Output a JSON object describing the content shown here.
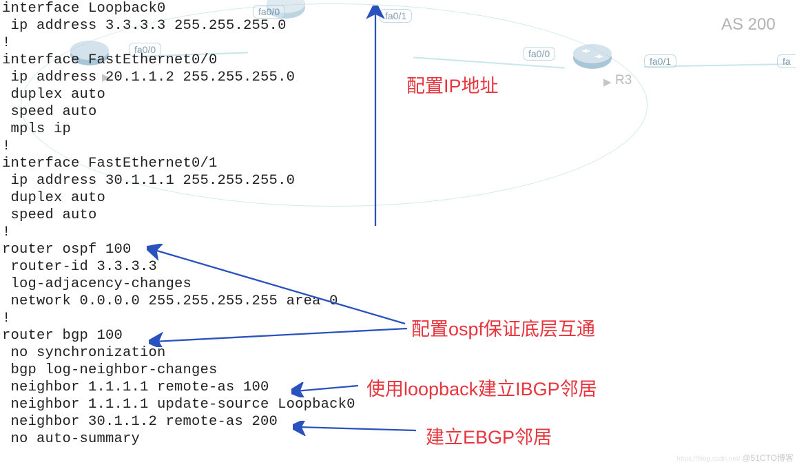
{
  "config_lines": [
    "interface Loopback0",
    " ip address 3.3.3.3 255.255.255.0",
    "!",
    "interface FastEthernet0/0",
    " ip address 20.1.1.2 255.255.255.0",
    " duplex auto",
    " speed auto",
    " mpls ip",
    "!",
    "interface FastEthernet0/1",
    " ip address 30.1.1.1 255.255.255.0",
    " duplex auto",
    " speed auto",
    "!",
    "router ospf 100",
    " router-id 3.3.3.3",
    " log-adjacency-changes",
    " network 0.0.0.0 255.255.255.255 area 0",
    "!",
    "router bgp 100",
    " no synchronization",
    " bgp log-neighbor-changes",
    " neighbor 1.1.1.1 remote-as 100",
    " neighbor 1.1.1.1 update-source Loopback0",
    " neighbor 30.1.1.2 remote-as 200",
    " no auto-summary"
  ],
  "annotations": {
    "ip": "配置IP地址",
    "ospf": "配置ospf保证底层互通",
    "ibgp": "使用loopback建立IBGP邻居",
    "ebgp": "建立EBGP邻居"
  },
  "topology": {
    "int_tags": [
      "fa0/0",
      "fa0/1",
      "fa0/0",
      "fa0/0",
      "fa0/1",
      "fa"
    ],
    "as_label": "AS 200",
    "router_label": "R3"
  },
  "arrow_color": "#2a52bf",
  "watermark": {
    "pre": "https://blog.csdn.net/ ",
    "text": "@51CTO博客"
  }
}
